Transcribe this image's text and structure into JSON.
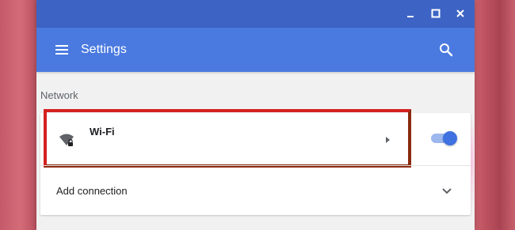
{
  "window": {
    "controls": {
      "minimize_icon": "minimize-icon",
      "maximize_icon": "maximize-icon",
      "close_icon": "close-icon"
    },
    "titlebar_color": "#3d64c4"
  },
  "appbar": {
    "menu_icon": "hamburger-menu-icon",
    "title": "Settings",
    "search_icon": "search-icon",
    "color": "#4a7ae0"
  },
  "network": {
    "section_label": "Network",
    "wifi": {
      "label": "Wi-Fi",
      "icon": "wifi-secure-icon",
      "toggle_on": true,
      "toggle_color": "#3f71e0"
    },
    "add_connection": {
      "label": "Add connection",
      "icon": "chevron-down-icon"
    }
  },
  "highlight": {
    "color": "#d42020"
  }
}
